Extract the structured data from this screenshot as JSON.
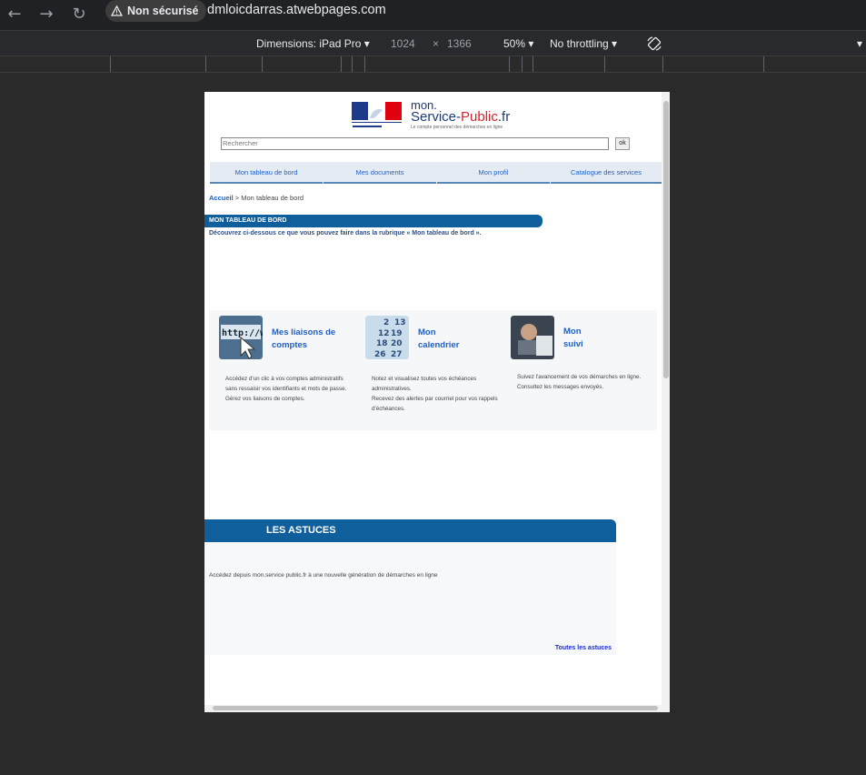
{
  "browser": {
    "back_icon": "arrow-left-icon",
    "forward_icon": "arrow-right-icon",
    "reload_icon": "reload-icon",
    "security_label": "Non sécurisé",
    "url": "dmloicdarras.atwebpages.com"
  },
  "devtools": {
    "dimensions_label": "Dimensions: iPad Pro",
    "width": "1024",
    "times": "×",
    "height": "1366",
    "zoom": "50%",
    "throttling": "No throttling"
  },
  "site": {
    "logo": {
      "line1": "mon.",
      "line2a": "Service-",
      "line2b": "Public",
      "line2c": ".fr",
      "tagline": "Le compte personnel des démarches en ligne"
    },
    "search": {
      "placeholder": "Rechercher",
      "ok_label": "ok"
    },
    "tabs": [
      {
        "label": "Mon tableau de bord"
      },
      {
        "label": "Mes documents"
      },
      {
        "label": "Mon profil"
      },
      {
        "label": "Catalogue des services"
      }
    ],
    "breadcrumb": {
      "home": "Accueil",
      "separator": ">",
      "current": "Mon tableau de bord"
    },
    "section_title": "MON TABLEAU DE BORD",
    "intro": "Découvrez ci-dessous ce que vous pouvez faire dans la rubrique « Mon tableau de bord ».",
    "cards": [
      {
        "title_line1": "Mes liaisons de",
        "title_line2": "comptes",
        "text1": "Accédez d'un clic à vos comptes administratifs sans ressaisir vos identifiants et mots de passe.",
        "text2": "Gérez vos liaisons de comptes."
      },
      {
        "title_line1": "Mon",
        "title_line2": "calendrier",
        "text1": "Notez et visualisez toutes vos échéances administratives.",
        "text2": "Recevez des alertes par courriel pour vos rappels d'échéances."
      },
      {
        "title_line1": "Mon",
        "title_line2": "suivi",
        "text1": "Suivez l'avancement de vos démarches en ligne.",
        "text2": "Consultez les messages envoyés."
      }
    ],
    "astuces": {
      "title": "LES ASTUCES",
      "text": "Accédez depuis mon.service public.fr à une nouvelle génération de démarches en ligne",
      "link": "Toutes les astuces"
    }
  }
}
